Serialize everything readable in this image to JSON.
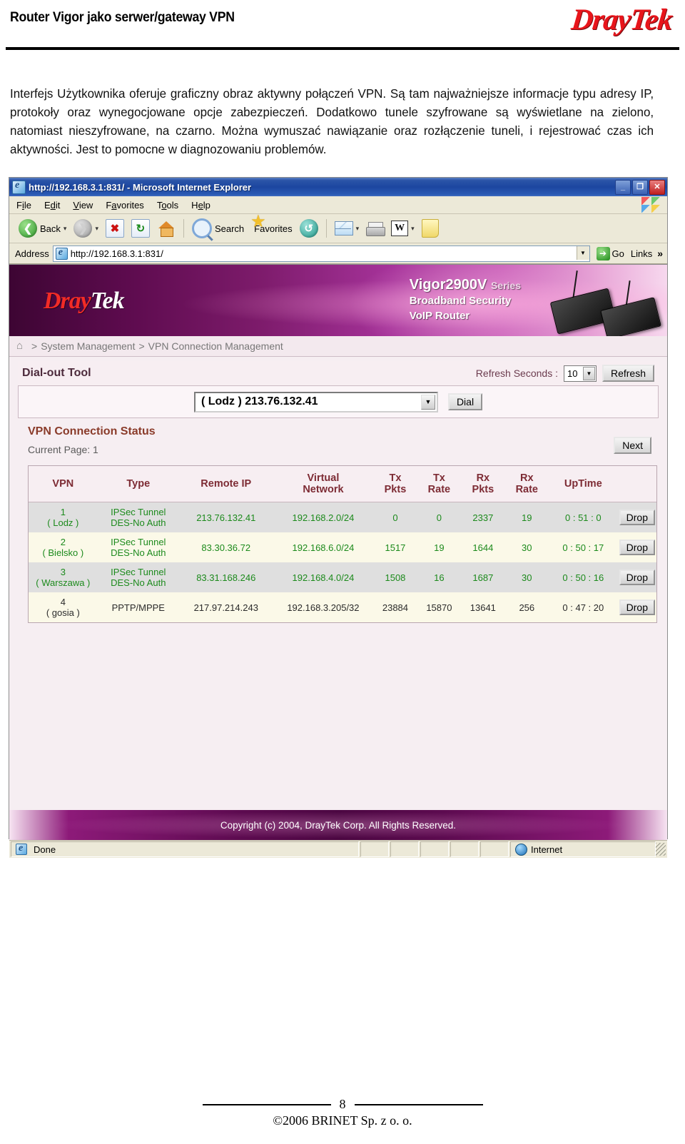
{
  "document": {
    "title": "Router Vigor jako serwer/gateway VPN",
    "logo_dray": "Dray",
    "logo_tek": "Tek",
    "intro": "Interfejs Użytkownika oferuje graficzny obraz aktywny połączeń VPN. Są tam najważniejsze informacje typu adresy IP, protokoły oraz wynegocjowane opcje zabezpieczeń. Dodatkowo tunele szyfrowane są wyświetlane na zielono, natomiast nieszyfrowane, na czarno. Można wymuszać nawiązanie oraz rozłączenie tuneli, i rejestrować czas ich aktywności. Jest to pomocne w diagnozowaniu problemów.",
    "page_number": "8",
    "footer_copyright": "©2006 BRINET Sp. z  o. o."
  },
  "browser": {
    "window_title": "http://192.168.3.1:831/ - Microsoft Internet Explorer",
    "minimize": "_",
    "maximize": "❐",
    "close": "✕",
    "menu": [
      {
        "pre": "F",
        "uk": "i",
        "post": "le"
      },
      {
        "pre": "E",
        "uk": "d",
        "post": "it"
      },
      {
        "pre": "",
        "uk": "V",
        "post": "iew"
      },
      {
        "pre": "F",
        "uk": "a",
        "post": "vorites"
      },
      {
        "pre": "T",
        "uk": "o",
        "post": "ols"
      },
      {
        "pre": "H",
        "uk": "e",
        "post": "lp"
      }
    ],
    "toolbar": {
      "back_label": "Back",
      "back_icon": "back-arrow-icon",
      "forward_icon": "forward-arrow-icon",
      "stop_icon": "stop-icon",
      "refresh_icon": "refresh-icon",
      "home_icon": "home-icon",
      "search_label": "Search",
      "search_icon": "magnifier-icon",
      "favorites_label": "Favorites",
      "favorites_icon": "star-icon",
      "history_icon": "history-icon",
      "mail_icon": "mail-icon",
      "print_icon": "print-icon",
      "word_icon": "word-icon",
      "notes_icon": "notes-icon",
      "dropdown_arrow": "▾"
    },
    "address": {
      "label": "Address",
      "value": "http://192.168.3.1:831/",
      "go_label": "Go",
      "links_label": "Links",
      "chevron": "»"
    },
    "status": {
      "done": "Done",
      "zone": "Internet"
    }
  },
  "router_ui": {
    "banner": {
      "logo_dray": "Dray",
      "logo_tek": "Tek",
      "model": "Vigor2900V",
      "series": "Series",
      "line2": "Broadband Security",
      "line3": "VoIP Router"
    },
    "breadcrumb": {
      "home_icon": "home-icon",
      "sep1": ">",
      "item1": "System Management",
      "sep2": ">",
      "item2": "VPN Connection Management"
    },
    "dialout": {
      "title": "Dial-out Tool",
      "refresh_label": "Refresh Seconds :",
      "refresh_seconds_value": "10",
      "refresh_button": "Refresh",
      "profile_value": "( Lodz ) 213.76.132.41",
      "dial_button": "Dial",
      "dropdown_arrow": "▼"
    },
    "status_section": {
      "title": "VPN Connection Status",
      "current_page": "Current Page: 1",
      "next_button": "Next"
    },
    "table": {
      "columns": [
        "VPN",
        "Type",
        "Remote IP",
        "Virtual\nNetwork",
        "Tx\nPkts",
        "Tx\nRate",
        "Rx\nPkts",
        "Rx\nRate",
        "UpTime",
        ""
      ],
      "col_vpn": "VPN",
      "col_type": "Type",
      "col_remote_ip": "Remote IP",
      "col_virtual_a": "Virtual",
      "col_virtual_b": "Network",
      "col_txpkts_a": "Tx",
      "col_txpkts_b": "Pkts",
      "col_txrate_a": "Tx",
      "col_txrate_b": "Rate",
      "col_rxpkts_a": "Rx",
      "col_rxpkts_b": "Pkts",
      "col_rxrate_a": "Rx",
      "col_rxrate_b": "Rate",
      "col_uptime": "UpTime",
      "rows": [
        {
          "index": "1",
          "name": "( Lodz )",
          "type_a": "IPSec Tunnel",
          "type_b": "DES-No Auth",
          "remote_ip": "213.76.132.41",
          "virtual_network": "192.168.2.0/24",
          "tx_pkts": "0",
          "tx_rate": "0",
          "rx_pkts": "2337",
          "rx_rate": "19",
          "uptime": "0 : 51 : 0",
          "action": "Drop",
          "encrypted": true
        },
        {
          "index": "2",
          "name": "( Bielsko )",
          "type_a": "IPSec Tunnel",
          "type_b": "DES-No Auth",
          "remote_ip": "83.30.36.72",
          "virtual_network": "192.168.6.0/24",
          "tx_pkts": "1517",
          "tx_rate": "19",
          "rx_pkts": "1644",
          "rx_rate": "30",
          "uptime": "0 : 50 : 17",
          "action": "Drop",
          "encrypted": true
        },
        {
          "index": "3",
          "name": "( Warszawa )",
          "type_a": "IPSec Tunnel",
          "type_b": "DES-No Auth",
          "remote_ip": "83.31.168.246",
          "virtual_network": "192.168.4.0/24",
          "tx_pkts": "1508",
          "tx_rate": "16",
          "rx_pkts": "1687",
          "rx_rate": "30",
          "uptime": "0 : 50 : 16",
          "action": "Drop",
          "encrypted": true
        },
        {
          "index": "4",
          "name": "( gosia )",
          "type_a": "PPTP/MPPE",
          "type_b": "",
          "remote_ip": "217.97.214.243",
          "virtual_network": "192.168.3.205/32",
          "tx_pkts": "23884",
          "tx_rate": "15870",
          "rx_pkts": "13641",
          "rx_rate": "256",
          "uptime": "0 : 47 : 20",
          "action": "Drop",
          "encrypted": false
        }
      ]
    },
    "footer_copyright": "Copyright (c) 2004, DrayTek Corp. All Rights Reserved."
  },
  "colors": {
    "encrypted_text": "#1c8a1c",
    "plain_text": "#2b2b2b",
    "brand_red": "#e8151b",
    "banner_purple": "#5d0b4e",
    "table_header_text": "#7d2b34"
  }
}
